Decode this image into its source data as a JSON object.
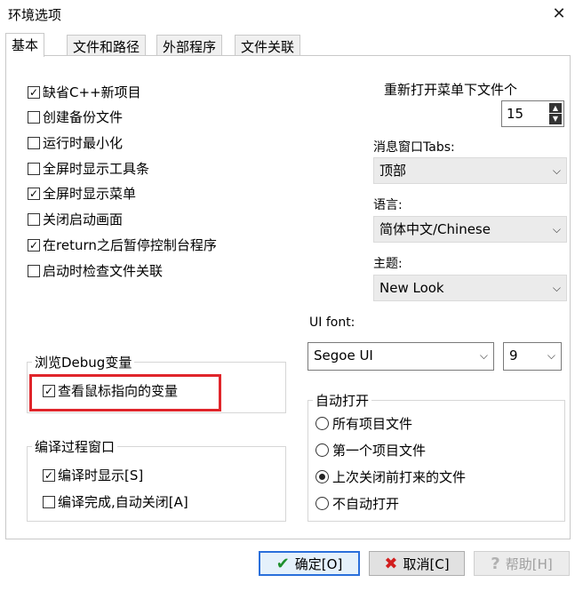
{
  "window": {
    "title": "环境选项",
    "close_glyph": "✕"
  },
  "tabs": [
    {
      "label": "基本",
      "active": true
    },
    {
      "label": "文件和路径",
      "active": false
    },
    {
      "label": "外部程序",
      "active": false
    },
    {
      "label": "文件关联",
      "active": false
    }
  ],
  "options": [
    {
      "label": "缺省C++新项目",
      "checked": true
    },
    {
      "label": "创建备份文件",
      "checked": false
    },
    {
      "label": "运行时最小化",
      "checked": false
    },
    {
      "label": "全屏时显示工具条",
      "checked": false
    },
    {
      "label": "全屏时显示菜单",
      "checked": true
    },
    {
      "label": "关闭启动画面",
      "checked": false
    },
    {
      "label": "在return之后暂停控制台程序",
      "checked": true
    },
    {
      "label": "启动时检查文件关联",
      "checked": false
    }
  ],
  "reopen": {
    "label": "重新打开菜单下文件个",
    "value": "15"
  },
  "msg_tabs": {
    "label": "消息窗口Tabs:",
    "value": "顶部"
  },
  "language": {
    "label": "语言:",
    "value": "简体中文/Chinese"
  },
  "theme": {
    "label": "主题:",
    "value": "New Look"
  },
  "ui_font": {
    "label": "UI font:",
    "font": "Segoe UI",
    "size": "9"
  },
  "debug_group": {
    "title": "浏览Debug变量",
    "option": {
      "label": "查看鼠标指向的变量",
      "checked": true
    }
  },
  "compile_group": {
    "title": "编译过程窗口",
    "options": [
      {
        "label": "编译时显示[S]",
        "checked": true
      },
      {
        "label": "编译完成,自动关闭[A]",
        "checked": false
      }
    ]
  },
  "autoopen_group": {
    "title": "自动打开",
    "options": [
      {
        "label": "所有项目文件",
        "selected": false
      },
      {
        "label": "第一个项目文件",
        "selected": false
      },
      {
        "label": "上次关闭前打来的文件",
        "selected": true
      },
      {
        "label": "不自动打开",
        "selected": false
      }
    ]
  },
  "buttons": {
    "ok": "确定[O]",
    "cancel": "取消[C]",
    "help": "帮助[H]"
  },
  "glyphs": {
    "check": "✓",
    "chevron": "⌵",
    "up": "▲",
    "down": "▼",
    "ok_icon": "✔",
    "cancel_icon": "✖",
    "help_icon": "?"
  },
  "colors": {
    "highlight": "#e0252b",
    "default_btn_border": "#2a6fdb",
    "ok_icon": "#1e8f2c",
    "cancel_icon": "#d21e1e"
  }
}
